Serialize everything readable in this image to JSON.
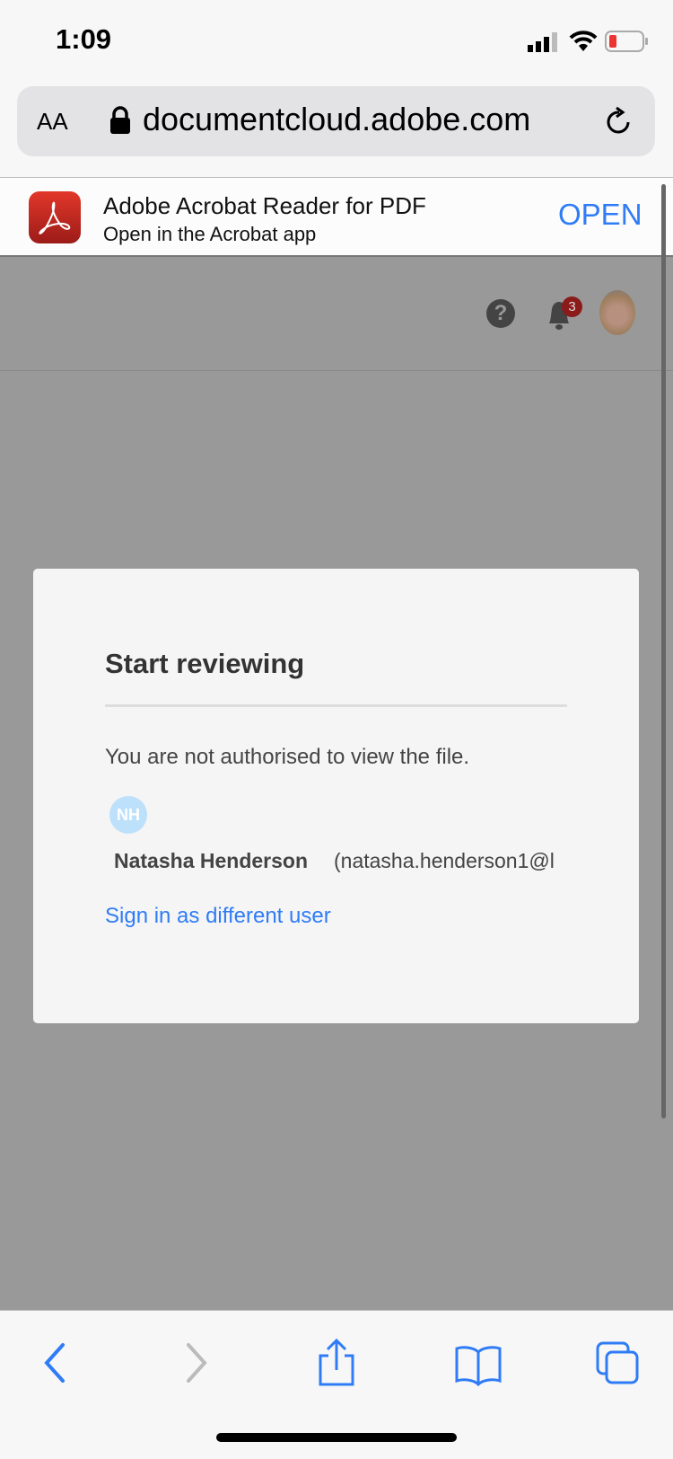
{
  "status_bar": {
    "time": "1:09"
  },
  "browser": {
    "text_size_label": "AA",
    "url": "documentcloud.adobe.com"
  },
  "app_banner": {
    "title": "Adobe Acrobat Reader for PDF",
    "subtitle": "Open in the Acrobat app",
    "open_label": "OPEN"
  },
  "header": {
    "help_glyph": "?",
    "notification_count": "3"
  },
  "dialog": {
    "title": "Start reviewing",
    "message": "You are not authorised to view the file.",
    "user_initials": "NH",
    "user_name": "Natasha Henderson",
    "user_email": "(natasha.henderson1@l",
    "sign_in_link": "Sign in as different user"
  },
  "colors": {
    "accent": "#2f7cf6",
    "badge": "#8b1a1a"
  }
}
